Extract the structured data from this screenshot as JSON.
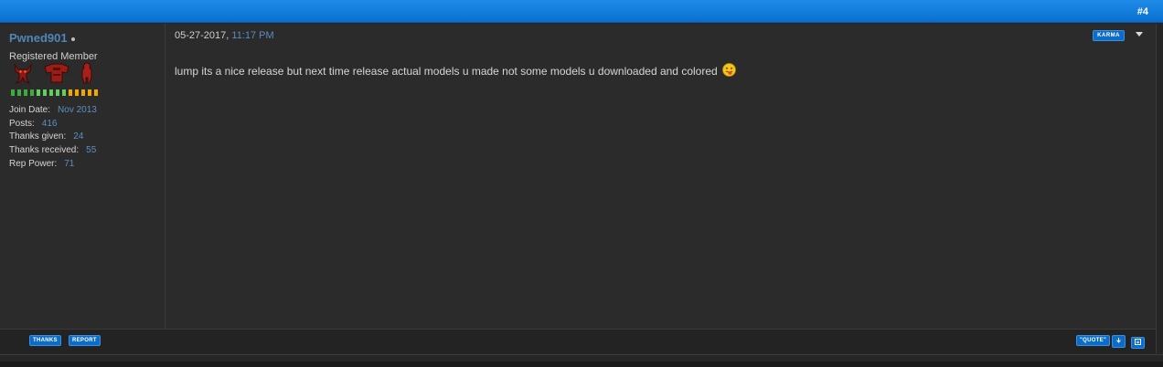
{
  "header": {
    "post_number": "#4"
  },
  "user": {
    "name": "Pwned901",
    "title": "Registered Member",
    "rank_icons": [
      "demon-rank-icon",
      "armor-rank-icon",
      "red-figure-rank-icon"
    ],
    "reputation_colors": [
      "#3caa3c",
      "#3caa3c",
      "#3caa3c",
      "#3caa3c",
      "#5fd05f",
      "#5fd05f",
      "#5fd05f",
      "#5fd05f",
      "#5fd05f",
      "#f0a800",
      "#f0a800",
      "#f0a800",
      "#f0a800",
      "#f0a800"
    ],
    "stats": [
      {
        "label": "Join Date:",
        "value": "Nov 2013"
      },
      {
        "label": "Posts:",
        "value": "416"
      },
      {
        "label": "Thanks given:",
        "value": "24"
      },
      {
        "label": "Thanks received:",
        "value": "55"
      },
      {
        "label": "Rep Power:",
        "value": "71"
      }
    ]
  },
  "post": {
    "date": "05-27-2017,",
    "time": "11:17 PM",
    "karma_label": "KARMA",
    "message": "lump its a nice release but next time release actual models u made not some models u downloaded and colored",
    "smiley": "tongue-smiley-icon"
  },
  "footer": {
    "thanks_label": "THANKS",
    "report_label": "REPORT",
    "quote_label": "\"QUOTE\""
  },
  "colors": {
    "accent": "#0b6dc8",
    "username": "#4f86b8",
    "background": "#2b2b2b"
  }
}
